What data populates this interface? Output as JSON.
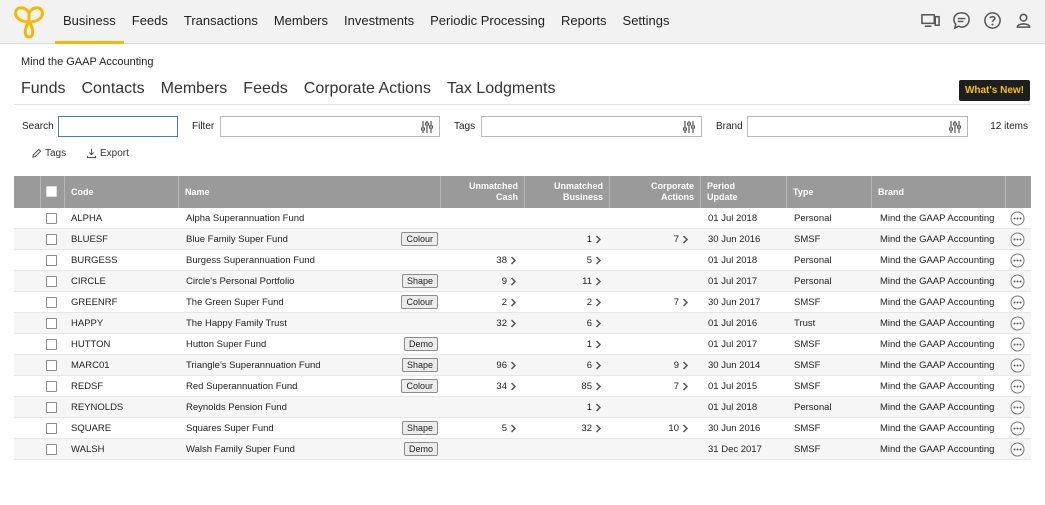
{
  "nav": {
    "items": [
      "Business",
      "Feeds",
      "Transactions",
      "Members",
      "Investments",
      "Periodic Processing",
      "Reports",
      "Settings"
    ],
    "active_index": 0,
    "icons": [
      "devices-icon",
      "chat-icon",
      "help-icon",
      "user-icon"
    ]
  },
  "company": "Mind the GAAP Accounting",
  "subnav": [
    "Funds",
    "Contacts",
    "Members",
    "Feeds",
    "Corporate Actions",
    "Tax Lodgments"
  ],
  "whats_new": "What's New!",
  "filters": {
    "search_label": "Search",
    "filter_label": "Filter",
    "tags_label": "Tags",
    "brand_label": "Brand",
    "search_value": "",
    "filter_value": "",
    "tags_value": "",
    "brand_value": ""
  },
  "items_count": "12 items",
  "actions": {
    "tags": "Tags",
    "export": "Export"
  },
  "colors": {
    "accent": "#f5b800",
    "header_bg": "#9a9a9a",
    "whats_new_bg": "#1e1e1e",
    "whats_new_fg": "#f5c400"
  },
  "columns": {
    "code": "Code",
    "name": "Name",
    "unmatched_cash": [
      "Unmatched",
      "Cash"
    ],
    "unmatched_business": [
      "Unmatched",
      "Business"
    ],
    "corporate_actions": [
      "Corporate",
      "Actions"
    ],
    "period_update": [
      "Period",
      "Update"
    ],
    "type": "Type",
    "brand": "Brand"
  },
  "rows": [
    {
      "code": "ALPHA",
      "name": "Alpha Superannuation Fund",
      "tag": "",
      "cash": "",
      "business": "",
      "corp": "",
      "period": "01 Jul 2018",
      "type": "Personal",
      "brand": "Mind the GAAP Accounting"
    },
    {
      "code": "BLUESF",
      "name": "Blue Family Super Fund",
      "tag": "Colour",
      "cash": "",
      "business": "1",
      "corp": "7",
      "period": "30 Jun 2016",
      "type": "SMSF",
      "brand": "Mind the GAAP Accounting"
    },
    {
      "code": "BURGESS",
      "name": "Burgess Superannuation Fund",
      "tag": "",
      "cash": "38",
      "business": "5",
      "corp": "",
      "period": "01 Jul 2018",
      "type": "Personal",
      "brand": "Mind the GAAP Accounting"
    },
    {
      "code": "CIRCLE",
      "name": "Circle's Personal Portfolio",
      "tag": "Shape",
      "cash": "9",
      "business": "11",
      "corp": "",
      "period": "01 Jul 2017",
      "type": "Personal",
      "brand": "Mind the GAAP Accounting"
    },
    {
      "code": "GREENRF",
      "name": "The Green Super Fund",
      "tag": "Colour",
      "cash": "2",
      "business": "2",
      "corp": "7",
      "period": "30 Jun 2017",
      "type": "SMSF",
      "brand": "Mind the GAAP Accounting"
    },
    {
      "code": "HAPPY",
      "name": "The Happy Family Trust",
      "tag": "",
      "cash": "32",
      "business": "6",
      "corp": "",
      "period": "01 Jul 2016",
      "type": "Trust",
      "brand": "Mind the GAAP Accounting"
    },
    {
      "code": "HUTTON",
      "name": "Hutton Super Fund",
      "tag": "Demo",
      "cash": "",
      "business": "1",
      "corp": "",
      "period": "01 Jul 2017",
      "type": "SMSF",
      "brand": "Mind the GAAP Accounting"
    },
    {
      "code": "MARC01",
      "name": "Triangle's Superannuation Fund",
      "tag": "Shape",
      "cash": "96",
      "business": "6",
      "corp": "9",
      "period": "30 Jun 2014",
      "type": "SMSF",
      "brand": "Mind the GAAP Accounting"
    },
    {
      "code": "REDSF",
      "name": "Red Superannuation Fund",
      "tag": "Colour",
      "cash": "34",
      "business": "85",
      "corp": "7",
      "period": "01 Jul 2015",
      "type": "SMSF",
      "brand": "Mind the GAAP Accounting"
    },
    {
      "code": "REYNOLDS",
      "name": "Reynolds Pension Fund",
      "tag": "",
      "cash": "",
      "business": "1",
      "corp": "",
      "period": "01 Jul 2018",
      "type": "Personal",
      "brand": "Mind the GAAP Accounting"
    },
    {
      "code": "SQUARE",
      "name": "Squares Super Fund",
      "tag": "Shape",
      "cash": "5",
      "business": "32",
      "corp": "10",
      "period": "30 Jun 2016",
      "type": "SMSF",
      "brand": "Mind the GAAP Accounting"
    },
    {
      "code": "WALSH",
      "name": "Walsh Family Super Fund",
      "tag": "Demo",
      "cash": "",
      "business": "",
      "corp": "",
      "period": "31 Dec 2017",
      "type": "SMSF",
      "brand": "Mind the GAAP Accounting"
    }
  ]
}
